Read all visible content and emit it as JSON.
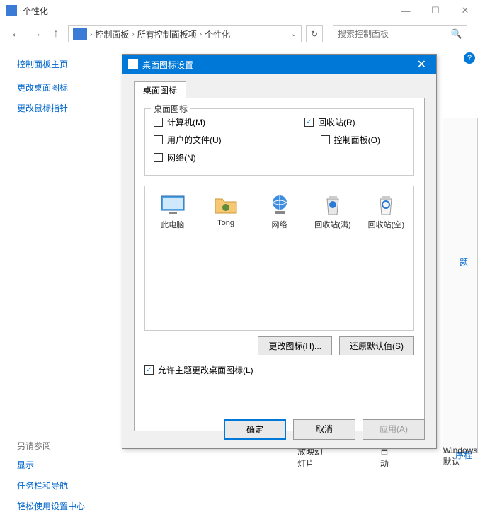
{
  "window": {
    "title": "个性化",
    "minimize": "—",
    "maximize": "☐",
    "close": "✕"
  },
  "nav": {
    "breadcrumb": [
      "控制面板",
      "所有控制面板项",
      "个性化"
    ],
    "search_placeholder": "搜索控制面板"
  },
  "sidebar": {
    "home": "控制面板主页",
    "links": [
      "更改桌面图标",
      "更改鼠标指针"
    ],
    "see_also_label": "另请参阅",
    "see_also": [
      "显示",
      "任务栏和导航",
      "轻松使用设置中心"
    ]
  },
  "dialog": {
    "title": "桌面图标设置",
    "tab": "桌面图标",
    "group_legend": "桌面图标",
    "checkboxes": {
      "computer": {
        "label": "计算机(M)",
        "checked": false
      },
      "recycle": {
        "label": "回收站(R)",
        "checked": true
      },
      "user_files": {
        "label": "用户的文件(U)",
        "checked": false
      },
      "control_panel": {
        "label": "控制面板(O)",
        "checked": false
      },
      "network": {
        "label": "网络(N)",
        "checked": false
      }
    },
    "icons": [
      {
        "name": "此电脑"
      },
      {
        "name": "Tong"
      },
      {
        "name": "网络"
      },
      {
        "name": "回收站(满)"
      },
      {
        "name": "回收站(空)"
      }
    ],
    "change_icon_btn": "更改图标(H)...",
    "restore_btn": "还原默认值(S)",
    "allow_theme": {
      "label": "允许主题更改桌面图标(L)",
      "checked": true
    },
    "ok": "确定",
    "cancel": "取消",
    "apply": "应用(A)"
  },
  "background": {
    "frag1": "题",
    "frag2": "序程",
    "row": [
      "放映幻灯片",
      "自动",
      "Windows 默认"
    ]
  }
}
